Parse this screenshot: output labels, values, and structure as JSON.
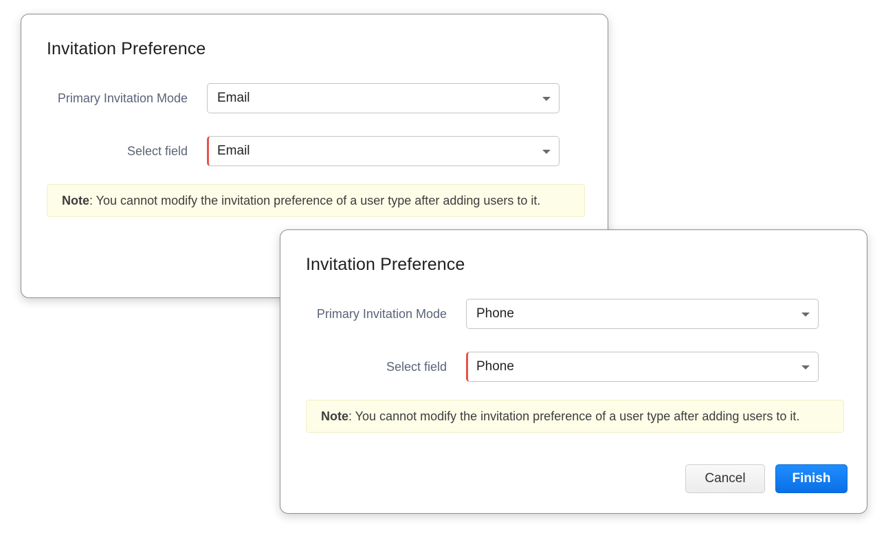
{
  "dialogs": [
    {
      "title": "Invitation Preference",
      "mode_label": "Primary Invitation Mode",
      "mode_value": "Email",
      "field_label": "Select field",
      "field_value": "Email",
      "note_prefix": "Note",
      "note_text": ": You cannot modify the invitation preference of a user type after adding users to it."
    },
    {
      "title": "Invitation Preference",
      "mode_label": "Primary Invitation Mode",
      "mode_value": "Phone",
      "field_label": "Select field",
      "field_value": "Phone",
      "note_prefix": "Note",
      "note_text": ": You cannot modify the invitation preference of a user type after adding users to it.",
      "cancel_label": "Cancel",
      "finish_label": "Finish"
    }
  ],
  "icons": {
    "dropdown": "chevron-down-icon"
  },
  "colors": {
    "primary_button": "#0a6fe6",
    "required_marker": "#e5534b",
    "note_background": "#fdfde8"
  }
}
